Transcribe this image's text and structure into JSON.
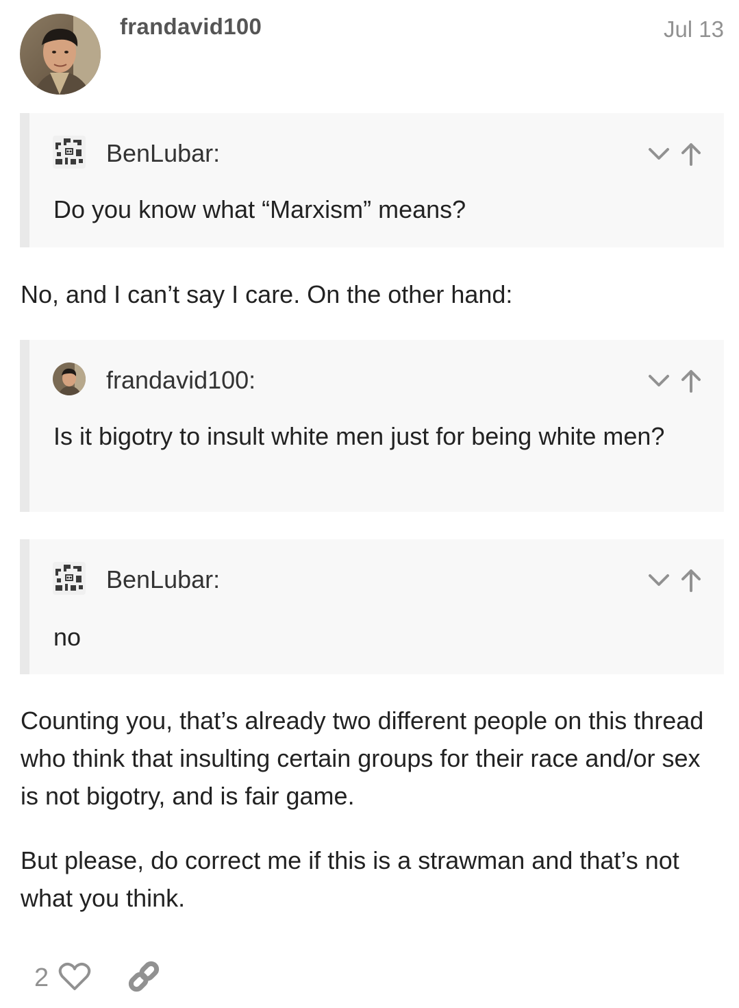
{
  "post": {
    "username": "frandavid100",
    "date": "Jul 13"
  },
  "quotes": [
    {
      "author": "BenLubar:",
      "text": "Do you know what “Marxism” means?"
    },
    {
      "author": "frandavid100:",
      "text": "Is it bigotry to insult white men just for being white men?"
    },
    {
      "author": "BenLubar:",
      "text": "no"
    }
  ],
  "paragraphs": [
    "No, and I can’t say I care. On the other hand:",
    "Counting you, that’s already two different people on this thread who think that insulting certain groups for their race and/or sex is not bigotry, and is fair game.",
    "But please, do correct me if this is a strawman and that’s not what you think."
  ],
  "actions": {
    "like_count": "2"
  },
  "icons": {
    "expand": "chevron-down-icon",
    "jump": "arrow-up-icon",
    "like": "heart-icon",
    "share": "link-icon"
  },
  "colors": {
    "muted": "#919191",
    "quote_bg": "#f8f8f8",
    "quote_border": "#e9e9e9"
  }
}
